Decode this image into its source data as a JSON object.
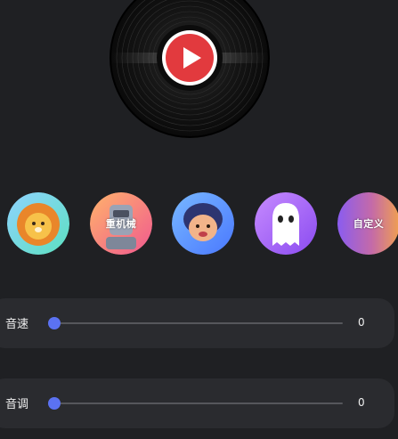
{
  "player": {
    "play_icon": "play-icon"
  },
  "voices": [
    {
      "id": "voice-lion",
      "label": "",
      "icon": "lion-avatar-icon"
    },
    {
      "id": "voice-mech",
      "label": "重机械",
      "icon": "robot-avatar-icon"
    },
    {
      "id": "voice-kid",
      "label": "",
      "icon": "kid-avatar-icon"
    },
    {
      "id": "voice-ghost",
      "label": "",
      "icon": "ghost-avatar-icon"
    },
    {
      "id": "voice-custom",
      "label": "自定义",
      "icon": ""
    }
  ],
  "sliders": {
    "speed": {
      "label": "音速",
      "value": "0",
      "fraction": 0
    },
    "pitch": {
      "label": "音调",
      "value": "0",
      "fraction": 0
    }
  },
  "colors": {
    "accent": "#5b72f2",
    "play": "#e23a3e"
  }
}
